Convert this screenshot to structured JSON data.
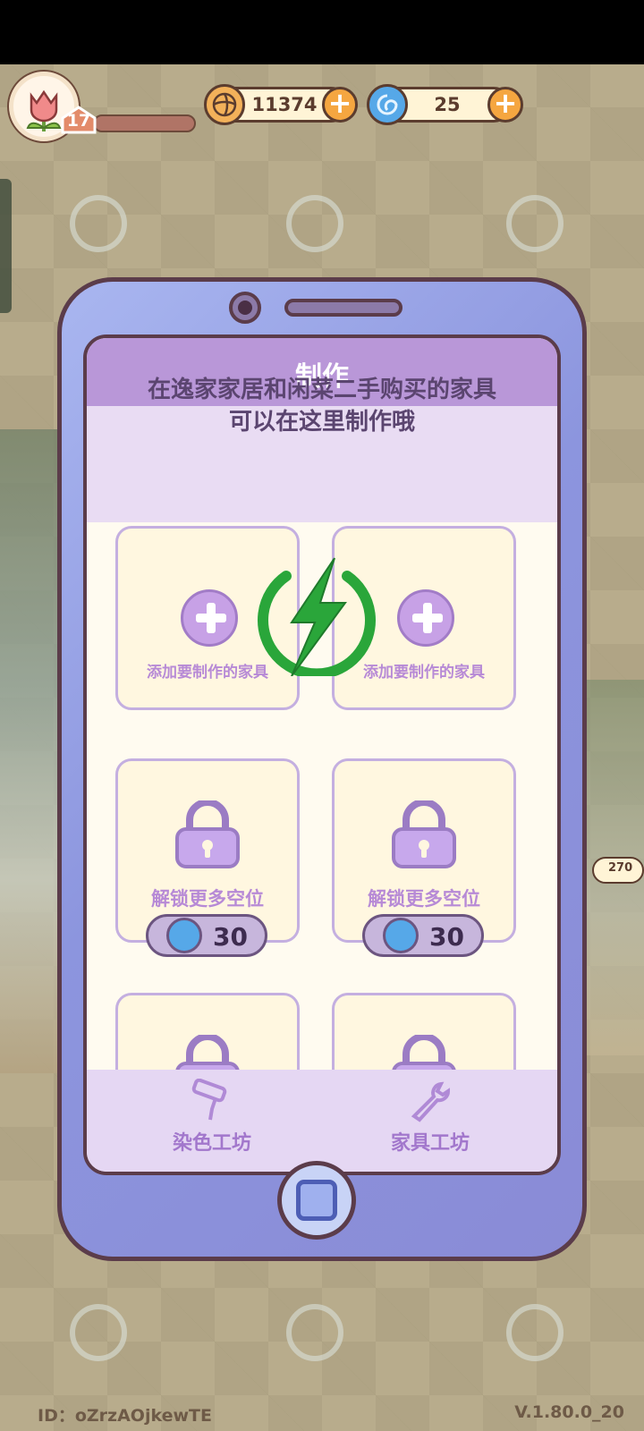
{
  "hud": {
    "level": "17",
    "coins": "11374",
    "gems": "25",
    "coin_icon": "flower-coin-icon",
    "gem_icon": "blue-swirl-icon"
  },
  "panel": {
    "title": "制作",
    "description_line1": "在逸家家居和闲菜二手购买的家具",
    "description_line2": "可以在这里制作哦",
    "add_slot_label": "添加要制作的家具",
    "locked_slot_label": "解锁更多空位",
    "unlock_cost": "30"
  },
  "tabs": {
    "dye_workshop": "染色工坊",
    "furniture_workshop": "家具工坊"
  },
  "scene": {
    "mailbox_count": "270"
  },
  "footer": {
    "id": "ID：oZrzAOjkewTE",
    "version": "V.1.80.0_20"
  },
  "colors": {
    "accent_purple": "#b997d8",
    "phone_blue": "#8c95de",
    "coin_orange": "#f5a640",
    "gem_blue": "#56a8e8",
    "overlay_green": "#2aa63a"
  }
}
